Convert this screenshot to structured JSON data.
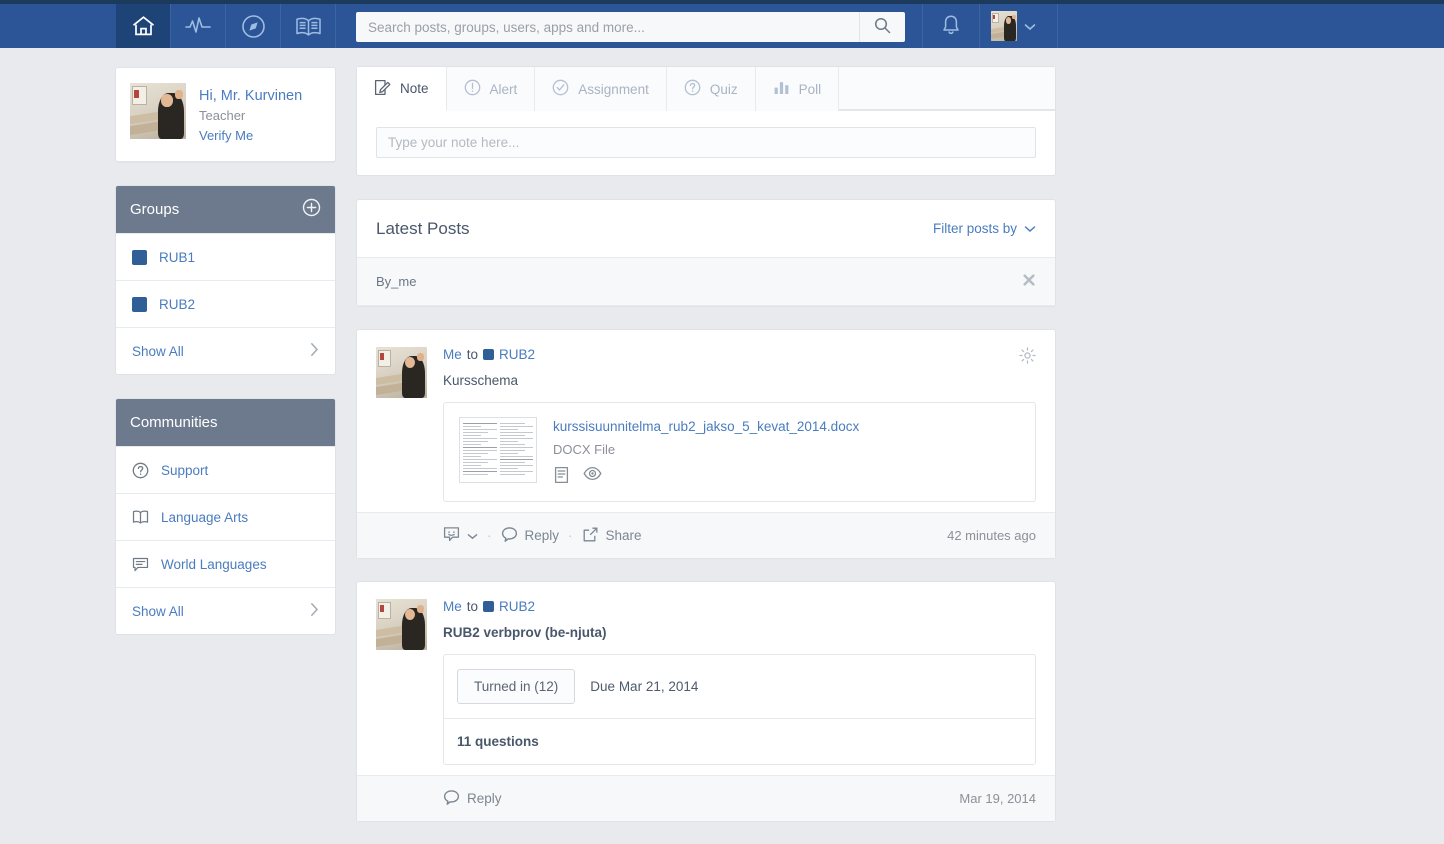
{
  "colors": {
    "topbar": "#2b5596",
    "topbar_dark": "#1b3a5c",
    "active_nav": "#1d4377",
    "link": "#4a7cbf",
    "panel_header": "#6d7a8d",
    "group_swatch": "#2f5f96",
    "page_bg": "#e8eaed"
  },
  "topbar": {
    "nav": [
      {
        "name": "home-icon",
        "label": "Home",
        "active": true
      },
      {
        "name": "activity-icon",
        "label": "Activity",
        "active": false
      },
      {
        "name": "compass-icon",
        "label": "Discover",
        "active": false
      },
      {
        "name": "book-icon",
        "label": "Library",
        "active": false
      }
    ],
    "search": {
      "placeholder": "Search posts, groups, users, apps and more...",
      "value": "",
      "icon": "search-icon"
    },
    "bell_icon": "bell-icon",
    "user_menu_icon": "chevron-down-icon"
  },
  "profile": {
    "greeting": "Hi, Mr. Kurvinen",
    "role": "Teacher",
    "verify": "Verify Me"
  },
  "groups": {
    "title": "Groups",
    "add_icon": "plus-circle-icon",
    "items": [
      {
        "label": "RUB1",
        "color": "#2f5f96"
      },
      {
        "label": "RUB2",
        "color": "#2f5f96"
      }
    ],
    "show_all": "Show All",
    "chevron": "›"
  },
  "communities": {
    "title": "Communities",
    "items": [
      {
        "label": "Support",
        "icon": "question-circle-icon"
      },
      {
        "label": "Language Arts",
        "icon": "book-open-icon"
      },
      {
        "label": "World Languages",
        "icon": "speech-bubble-icon"
      }
    ],
    "show_all": "Show All",
    "chevron": "›"
  },
  "composer": {
    "tabs": [
      {
        "label": "Note",
        "icon": "note-pencil-icon",
        "active": true
      },
      {
        "label": "Alert",
        "icon": "alert-circle-icon",
        "active": false
      },
      {
        "label": "Assignment",
        "icon": "check-circle-icon",
        "active": false
      },
      {
        "label": "Quiz",
        "icon": "question-circle-icon",
        "active": false
      },
      {
        "label": "Poll",
        "icon": "bar-chart-icon",
        "active": false
      }
    ],
    "input_placeholder": "Type your note here...",
    "input_value": ""
  },
  "feed": {
    "title": "Latest Posts",
    "filter_label": "Filter posts by",
    "filter_chevron_icon": "chevron-down-icon",
    "active_filter": "By_me",
    "clear_icon": "close-icon"
  },
  "posts": [
    {
      "author": "Me",
      "to_word": "to",
      "group": "RUB2",
      "group_color": "#2f5f96",
      "gear_icon": "gear-icon",
      "text": "Kursschema",
      "bold_text": false,
      "attachment": {
        "filename": "kurssisuunnitelma_rub2_jakso_5_kevat_2014.docx",
        "filetype": "DOCX File",
        "actions": [
          {
            "icon": "document-icon",
            "label": "Open document"
          },
          {
            "icon": "eye-icon",
            "label": "Preview"
          }
        ]
      },
      "footer": {
        "reaction_icon": "emoji-icon",
        "reaction_chevron_icon": "chevron-down-icon",
        "reply_icon": "comment-icon",
        "reply_label": "Reply",
        "share_icon": "share-icon",
        "share_label": "Share",
        "timestamp": "42 minutes ago"
      }
    },
    {
      "author": "Me",
      "to_word": "to",
      "group": "RUB2",
      "group_color": "#2f5f96",
      "text": "RUB2 verbprov (be-njuta)",
      "bold_text": true,
      "assignment": {
        "turned_in": "Turned in (12)",
        "due": "Due Mar 21, 2014",
        "questions": "11 questions"
      },
      "footer": {
        "reply_icon": "comment-icon",
        "reply_label": "Reply",
        "timestamp": "Mar 19, 2014"
      }
    }
  ]
}
